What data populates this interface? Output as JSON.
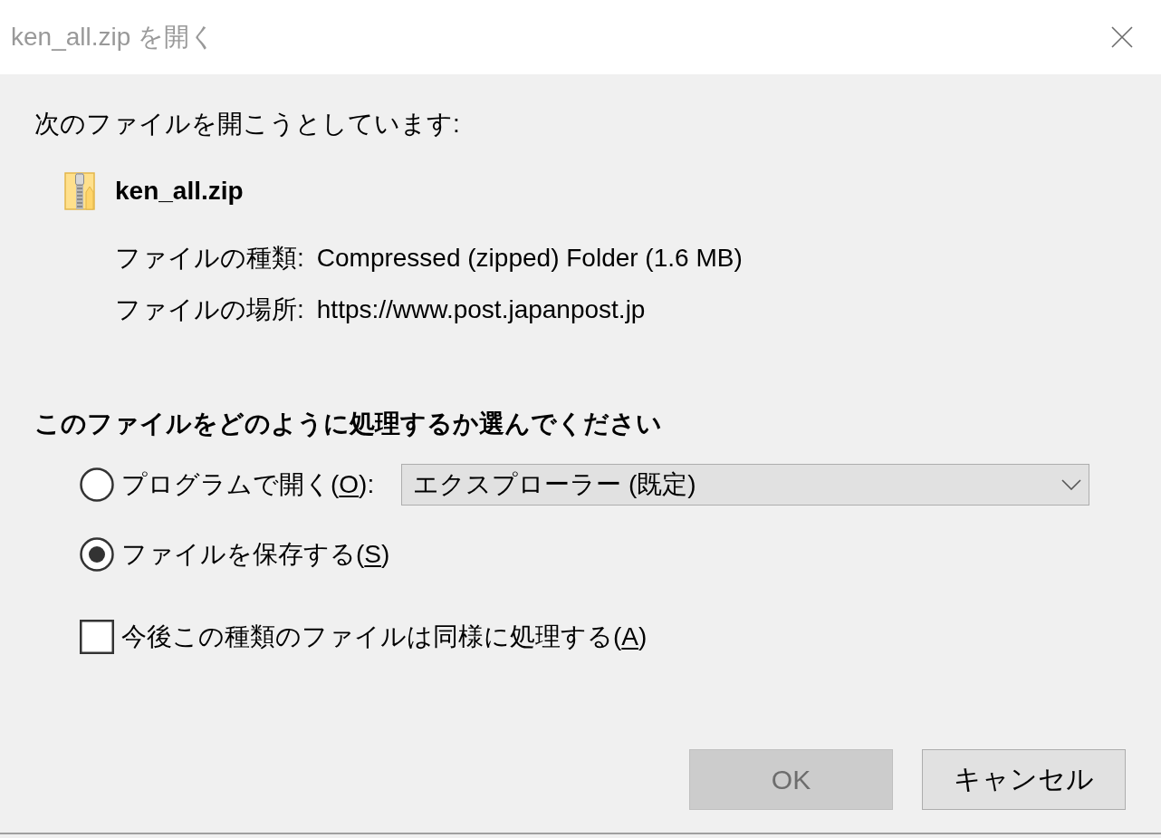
{
  "window": {
    "title": "ken_all.zip を開く"
  },
  "intro": "次のファイルを開こうとしています:",
  "file": {
    "name": "ken_all.zip",
    "details": [
      {
        "label": "ファイルの種類:",
        "value": "Compressed (zipped) Folder (1.6 MB)"
      },
      {
        "label": "ファイルの場所:",
        "value": "https://www.post.japanpost.jp"
      }
    ]
  },
  "action_heading": "このファイルをどのように処理するか選んでください",
  "options": [
    {
      "text_before": "プログラムで開く(",
      "access_key": "O",
      "text_after": "):",
      "selected": false,
      "dropdown": {
        "value": "エクスプローラー (既定)"
      }
    },
    {
      "text_before": "ファイルを保存する(",
      "access_key": "S",
      "text_after": ")",
      "selected": true
    }
  ],
  "remember": {
    "text_before": "今後この種類のファイルは同様に処理する(",
    "access_key": "A",
    "text_after": ")",
    "checked": false
  },
  "buttons": [
    {
      "label": "OK",
      "disabled": true
    },
    {
      "label": "キャンセル",
      "disabled": false
    }
  ]
}
